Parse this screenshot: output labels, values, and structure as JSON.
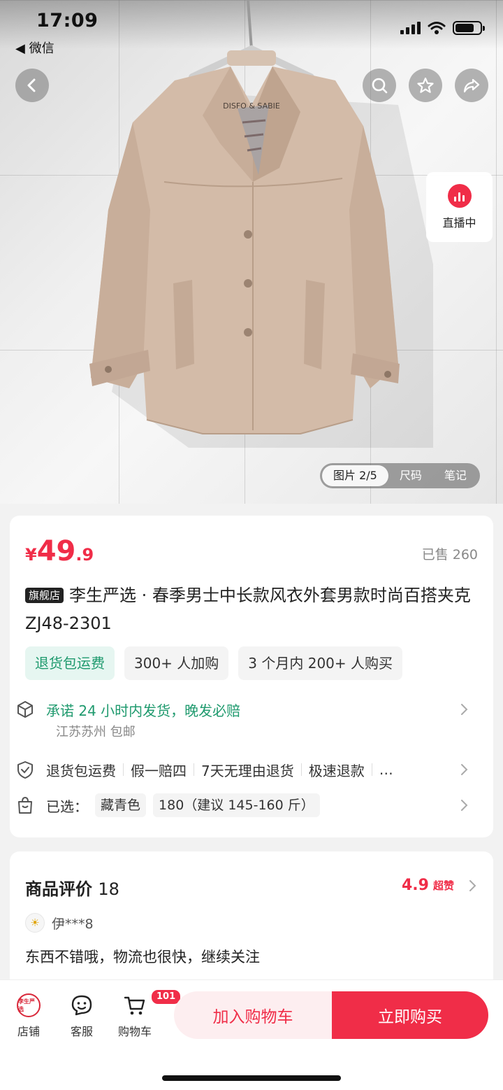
{
  "status_bar": {
    "time": "17:09",
    "back_app": "◀ 微信"
  },
  "hero": {
    "live_label": "直播中",
    "pager": {
      "image_index": "图片 2/5",
      "size": "尺码",
      "notes": "笔记"
    },
    "hanger_brand": "DISFO & SABIE"
  },
  "product": {
    "price_symbol": "¥",
    "price_int": "49",
    "price_dec": ".9",
    "sold": "已售 260",
    "flag": "旗舰店",
    "title": "李生严选 · 春季男士中长款风衣外套男款时尚百搭夹克 ZJ48-2301",
    "tags": [
      "退货包运费",
      "300+ 人加购",
      "3 个月内 200+ 人购买"
    ]
  },
  "shipping": {
    "promise": "承诺 24 小时内发货，晚发必赔",
    "origin": "江苏苏州 包邮"
  },
  "services": [
    "退货包运费",
    "假一赔四",
    "7天无理由退货",
    "极速退款",
    "…"
  ],
  "selection": {
    "label": "已选：",
    "color": "藏青色",
    "size": "180（建议 145-160 斤）"
  },
  "reviews": {
    "title": "商品评价",
    "count": "18",
    "score": "4.9",
    "score_label": "超赞",
    "user": "伊***8",
    "text": "东西不错哦，物流也很快，继续关注"
  },
  "bottom_bar": {
    "store": "店铺",
    "store_logo": "李生严选",
    "service": "客服",
    "cart": "购物车",
    "cart_badge": "101",
    "add_to_cart": "加入购物车",
    "buy_now": "立即购买"
  },
  "colors": {
    "accent": "#f02d48",
    "green": "#1f9a6e",
    "coat": "#d3bba8"
  }
}
